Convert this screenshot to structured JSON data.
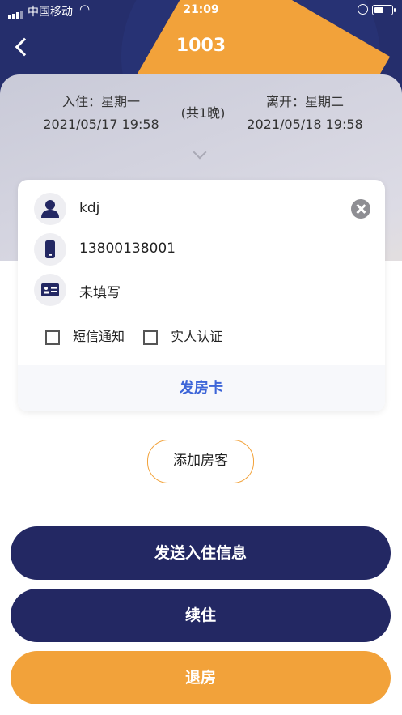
{
  "status": {
    "carrier": "中国移动",
    "time": "21:09"
  },
  "header": {
    "title": "1003"
  },
  "stay": {
    "checkin_label": "入住：星期一",
    "checkin_time": "2021/05/17 19:58",
    "nights": "(共1晚)",
    "checkout_label": "离开：星期二",
    "checkout_time": "2021/05/18 19:58"
  },
  "guest": {
    "name": "kdj",
    "phone": "13800138001",
    "id_card": "未填写",
    "sms_notify_label": "短信通知",
    "realname_auth_label": "实人认证",
    "issue_card_label": "发房卡"
  },
  "actions": {
    "add_guest": "添加房客",
    "send_checkin": "发送入住信息",
    "extend_stay": "续住",
    "checkout": "退房"
  },
  "colors": {
    "navy": "#232863",
    "orange": "#f2a23a",
    "link_blue": "#3d65d8"
  }
}
